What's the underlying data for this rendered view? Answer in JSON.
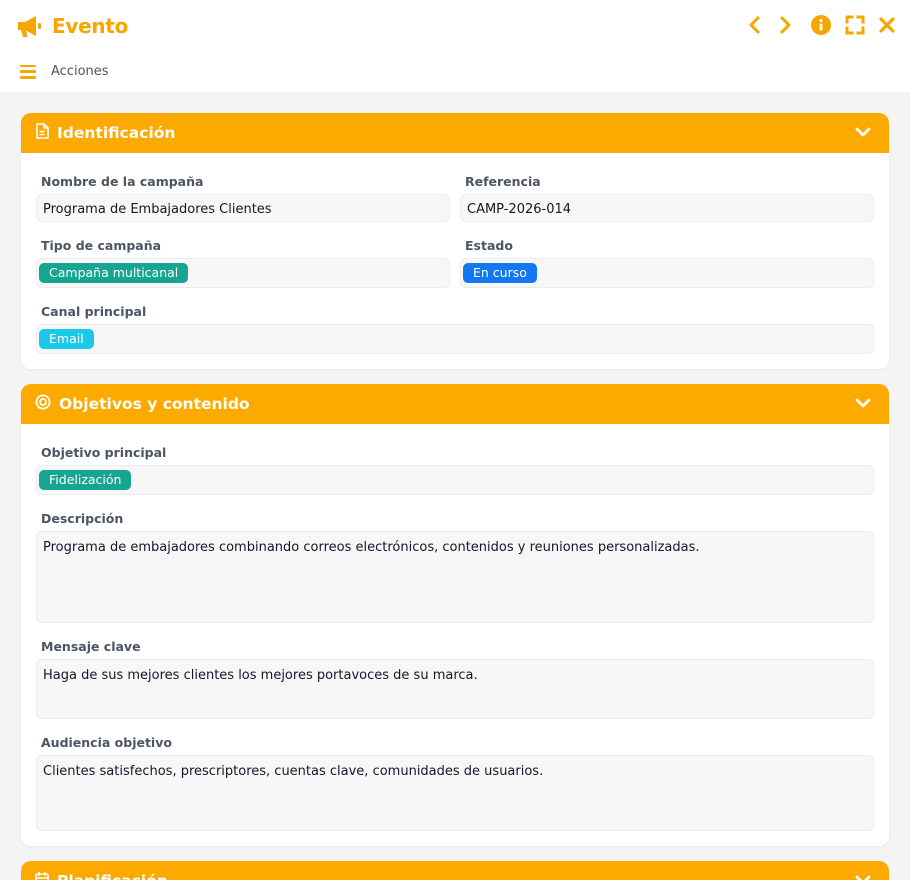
{
  "window": {
    "title": "Evento",
    "actions_label": "Acciones"
  },
  "colors": {
    "accent": "#f5a700",
    "panel_header": "#fdaa00",
    "chip_teal": "#16a590",
    "chip_blue": "#1277f0",
    "chip_cyan": "#1ac8e9"
  },
  "identificacion": {
    "title": "Identificación",
    "icon": "document-icon",
    "nombre_label": "Nombre de la campaña",
    "nombre_value": "Programa de Embajadores Clientes",
    "referencia_label": "Referencia",
    "referencia_value": "CAMP-2026-014",
    "tipo_label": "Tipo de campaña",
    "tipo_value": "Campaña multicanal",
    "estado_label": "Estado",
    "estado_value": "En curso",
    "canal_label": "Canal principal",
    "canal_value": "Email"
  },
  "objetivos": {
    "title": "Objetivos y contenido",
    "icon": "target-icon",
    "objetivo_label": "Objetivo principal",
    "objetivo_value": "Fidelización",
    "descripcion_label": "Descripción",
    "descripcion_value": "Programa de embajadores combinando correos electrónicos, contenidos y reuniones personalizadas.",
    "mensaje_label": "Mensaje clave",
    "mensaje_value": "Haga de sus mejores clientes los mejores portavoces de su marca.",
    "audiencia_label": "Audiencia objetivo",
    "audiencia_value": "Clientes satisfechos, prescriptores, cuentas clave, comunidades de usuarios."
  },
  "planificacion": {
    "title": "Planificación",
    "icon": "calendar-icon"
  }
}
